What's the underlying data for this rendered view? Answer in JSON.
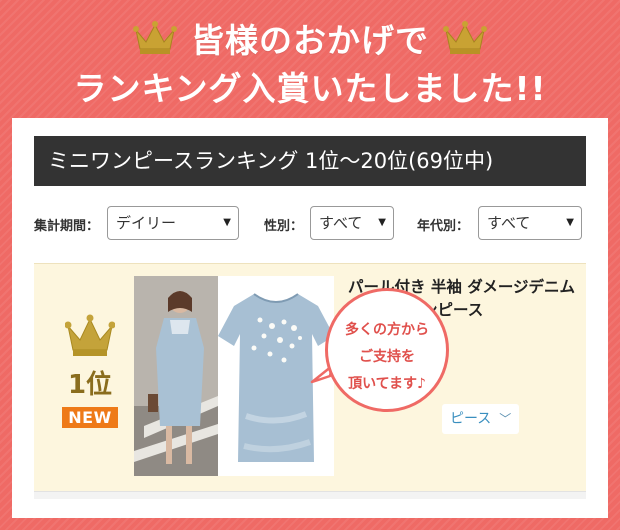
{
  "banner": {
    "line1": "皆様のおかげで",
    "line2": "ランキング入賞いたしました!!",
    "crown_icon": "crown-icon",
    "text_color": "#ffffff",
    "background_color": "#ef6a65"
  },
  "section": {
    "title": "ミニワンピースランキング 1位〜20位(69位中)"
  },
  "filters": {
    "period_label": "集計期間：",
    "period_value": "デイリー",
    "gender_label": "性別：",
    "gender_value": "すべて",
    "age_label": "年代別：",
    "age_value": "すべて",
    "dropdown_icon": "caret-down-icon"
  },
  "ranking": {
    "rank_label": "1位",
    "new_label": "NEW",
    "title": "パール付き 半袖 ダメージデニム Aラインワンピース",
    "category_text": "ピース",
    "category_icon": "chevron-down-icon",
    "bubble_line1": "多くの方から",
    "bubble_line2": "ご支持を",
    "bubble_line3": "頂いてます♪",
    "accent_color": "#ee7a18",
    "gold_color": "#8a6d1d"
  }
}
